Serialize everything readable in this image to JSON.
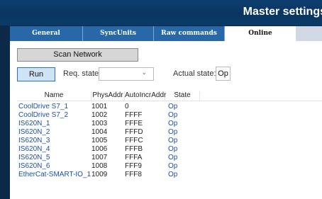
{
  "window": {
    "title": "Master settings"
  },
  "tabs": [
    {
      "label": "General"
    },
    {
      "label": "SyncUnits"
    },
    {
      "label": "Raw commands"
    },
    {
      "label": "Online"
    }
  ],
  "online": {
    "scan_button": "Scan Network",
    "run_button": "Run",
    "req_state_label": "Req. state:",
    "req_state_value": "",
    "actual_state_label": "Actual state:",
    "actual_state_value": "Op"
  },
  "table": {
    "columns": [
      "Name",
      "PhysAddr",
      "AutoIncrAddr",
      "State"
    ],
    "rows": [
      {
        "name": "CoolDrive S7_1",
        "phys": "1001",
        "auto": "0",
        "state": "Op"
      },
      {
        "name": "CoolDrive S7_2",
        "phys": "1002",
        "auto": "FFFF",
        "state": "Op"
      },
      {
        "name": "IS620N_1",
        "phys": "1003",
        "auto": "FFFE",
        "state": "Op"
      },
      {
        "name": "IS620N_2",
        "phys": "1004",
        "auto": "FFFD",
        "state": "Op"
      },
      {
        "name": "IS620N_3",
        "phys": "1005",
        "auto": "FFFC",
        "state": "Op"
      },
      {
        "name": "IS620N_4",
        "phys": "1006",
        "auto": "FFFB",
        "state": "Op"
      },
      {
        "name": "IS620N_5",
        "phys": "1007",
        "auto": "FFFA",
        "state": "Op"
      },
      {
        "name": "IS620N_6",
        "phys": "1008",
        "auto": "FFF9",
        "state": "Op"
      },
      {
        "name": "EtherCat-SMART-IO_1",
        "phys": "1009",
        "auto": "FFF8",
        "state": "Op"
      }
    ]
  }
}
